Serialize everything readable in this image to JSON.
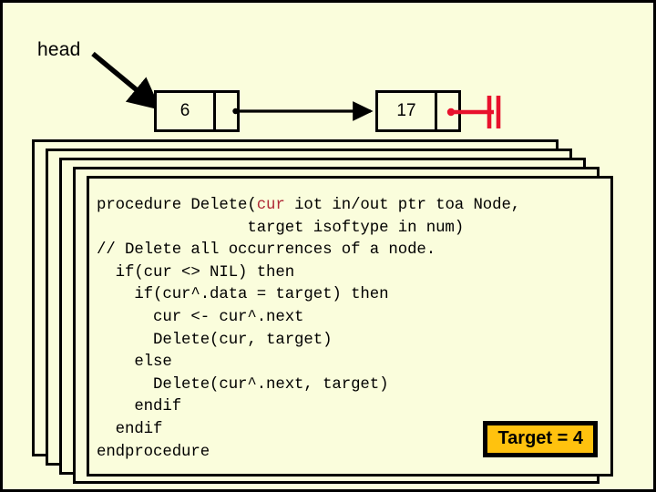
{
  "slide": {
    "background_color": "#fafddc",
    "border_color": "#000000"
  },
  "diagram": {
    "head_label": "head",
    "head_arrow_icon": "arrow-down-right-icon",
    "link_arrow_icon": "arrow-right-icon",
    "nil_marker_icon": "nil-ground-icon",
    "nil_marker_color": "#e8112d",
    "nodes": [
      {
        "value": "6",
        "pointer": "next"
      },
      {
        "value": "17",
        "pointer": "nil"
      }
    ]
  },
  "code_card": {
    "stack_count": 5,
    "highlight_color": "#b02a37",
    "highlighted_token": "cur",
    "lines": [
      "procedure Delete(cur iot in/out ptr toa Node,",
      "                target isoftype in num)",
      "// Delete all occurrences of a node.",
      "  if(cur <> NIL) then",
      "    if(cur^.data = target) then",
      "      cur <- cur^.next",
      "      Delete(cur, target)",
      "    else",
      "      Delete(cur^.next, target)",
      "    endif",
      "  endif",
      "endprocedure"
    ]
  },
  "target_badge": {
    "label": "Target = 4",
    "background_color": "#ffc20e",
    "text_color": "#000000"
  }
}
